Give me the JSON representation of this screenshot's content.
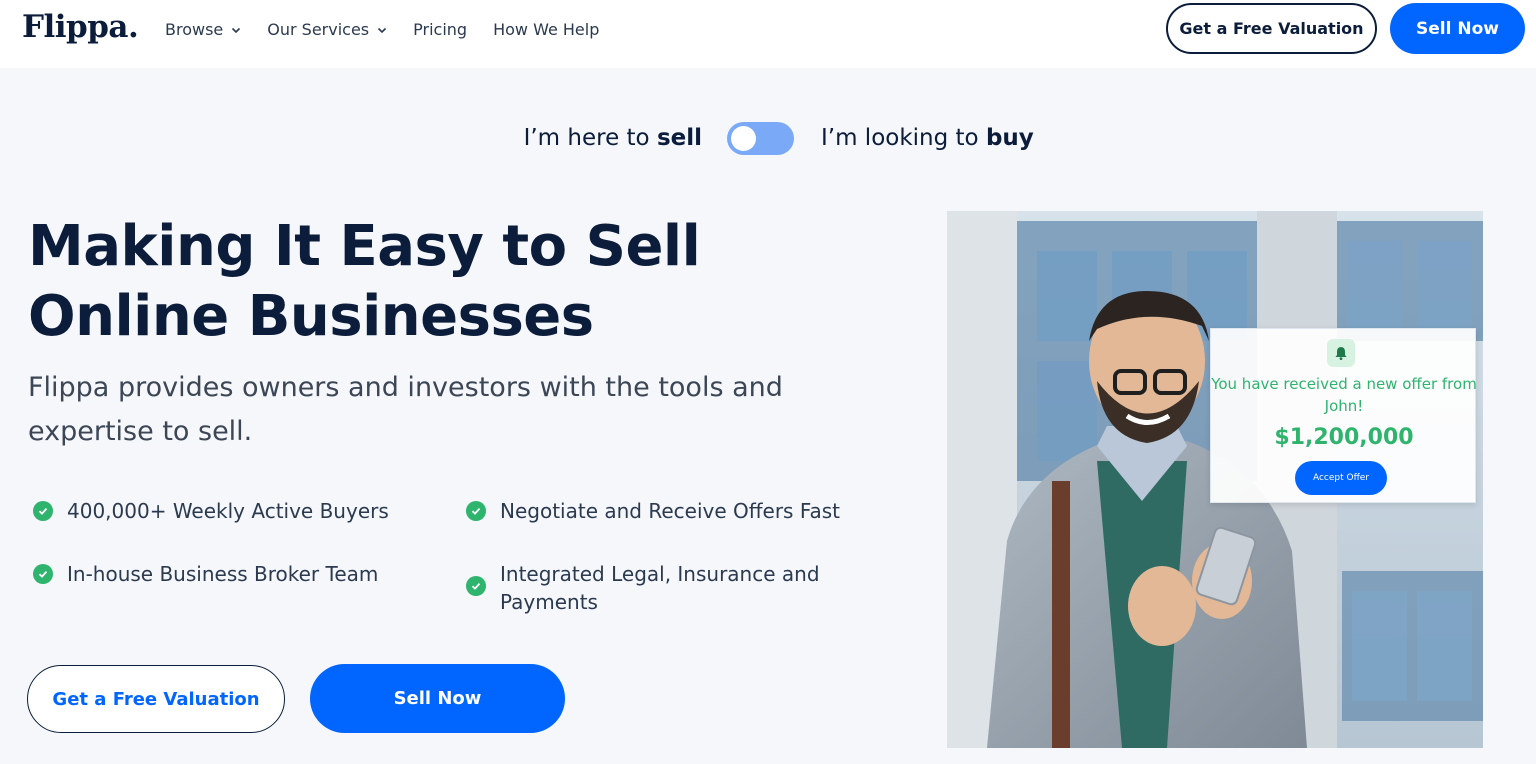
{
  "header": {
    "logo": "Flippa.",
    "nav": [
      {
        "label": "Browse",
        "has_dropdown": true
      },
      {
        "label": "Our Services",
        "has_dropdown": true
      },
      {
        "label": "Pricing",
        "has_dropdown": false
      },
      {
        "label": "How We Help",
        "has_dropdown": false
      }
    ],
    "valuation_label": "Get a Free Valuation",
    "sell_label": "Sell Now"
  },
  "toggle": {
    "left_prefix": "I’m here to ",
    "left_bold": "sell",
    "right_prefix": "I’m looking to ",
    "right_bold": "buy",
    "state": "sell"
  },
  "hero": {
    "headline_line1": "Making It Easy to Sell",
    "headline_line2": "Online Businesses",
    "subhead": "Flippa provides owners and investors with the tools and expertise to sell.",
    "features": [
      "400,000+ Weekly Active Buyers",
      "Negotiate and Receive Offers Fast",
      "In-house Business Broker Team",
      "Integrated Legal, Insurance and Payments"
    ],
    "valuation_label": "Get a Free Valuation",
    "sell_label": "Sell Now"
  },
  "offer_card": {
    "icon": "bell-icon",
    "message": "You have received a new offer from John!",
    "amount": "$1,200,000",
    "button_label": "Accept Offer"
  },
  "colors": {
    "primary": "#0066ff",
    "navy": "#0b1d3a",
    "success": "#2fb46e",
    "page_bg": "#f5f7fb"
  }
}
